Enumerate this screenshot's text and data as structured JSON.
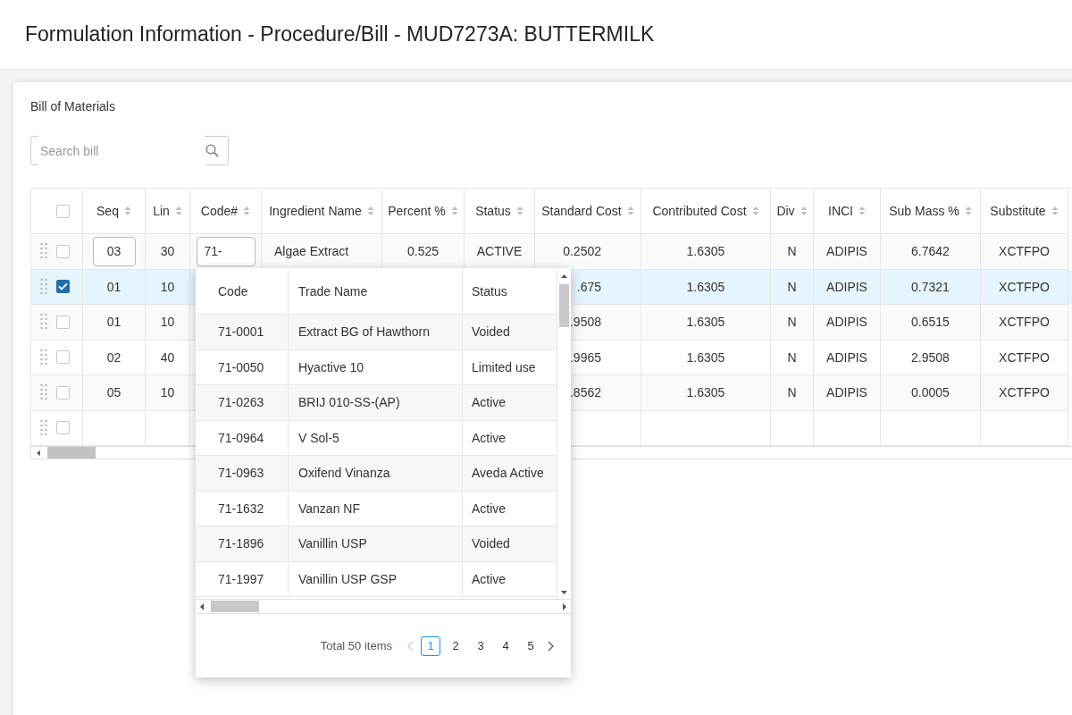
{
  "page_title": "Formulation Information - Procedure/Bill - MUD7273A: BUTTERMILK",
  "card_title": "Bill of Materials",
  "search": {
    "placeholder": "Search bill"
  },
  "table": {
    "all_checked": false,
    "columns": [
      {
        "label": "Seq"
      },
      {
        "label": "Lin"
      },
      {
        "label": "Code#"
      },
      {
        "label": "Ingredient Name"
      },
      {
        "label": "Percent %"
      },
      {
        "label": "Status"
      },
      {
        "label": "Standard Cost"
      },
      {
        "label": "Contributed Cost"
      },
      {
        "label": "Div"
      },
      {
        "label": "INCI"
      },
      {
        "label": "Sub Mass %"
      },
      {
        "label": "Substitute"
      }
    ],
    "rows": [
      {
        "selected": false,
        "editing": true,
        "seq": "03",
        "lin": "30",
        "code": "71-",
        "ingredient_name": "Algae Extract",
        "percent": "0.525",
        "status": "ACTIVE",
        "standard_cost": "0.2502",
        "contributed_cost": "1.6305",
        "div": "N",
        "inci": "ADIPIS",
        "sub_mass": "6.7642",
        "substitute": "XCTFPO"
      },
      {
        "selected": true,
        "editing": false,
        "seq": "01",
        "lin": "10",
        "standard_cost": ".675",
        "contributed_cost": "1.6305",
        "div": "N",
        "inci": "ADIPIS",
        "sub_mass": "0.7321",
        "substitute": "XCTFPO"
      },
      {
        "selected": false,
        "editing": false,
        "seq": "01",
        "lin": "10",
        "standard_cost": ".9508",
        "contributed_cost": "1.6305",
        "div": "N",
        "inci": "ADIPIS",
        "sub_mass": "0.6515",
        "substitute": "XCTFPO"
      },
      {
        "selected": false,
        "editing": false,
        "seq": "02",
        "lin": "40",
        "standard_cost": ".9965",
        "contributed_cost": "1.6305",
        "div": "N",
        "inci": "ADIPIS",
        "sub_mass": "2.9508",
        "substitute": "XCTFPO"
      },
      {
        "selected": false,
        "editing": false,
        "seq": "05",
        "lin": "10",
        "standard_cost": ".8562",
        "contributed_cost": "1.6305",
        "div": "N",
        "inci": "ADIPIS",
        "sub_mass": "0.0005",
        "substitute": "XCTFPO"
      },
      {
        "selected": false,
        "editing": false
      }
    ]
  },
  "lookup": {
    "columns": [
      {
        "label": "Code"
      },
      {
        "label": "Trade Name"
      },
      {
        "label": "Status"
      }
    ],
    "rows": [
      {
        "code": "71-0001",
        "trade_name": "Extract BG of Hawthorn",
        "status": "Voided"
      },
      {
        "code": "71-0050",
        "trade_name": "Hyactive 10",
        "status": "Limited use"
      },
      {
        "code": "71-0263",
        "trade_name": "BRIJ 010-SS-(AP)",
        "status": "Active"
      },
      {
        "code": "71-0964",
        "trade_name": "V Sol-5",
        "status": "Active"
      },
      {
        "code": "71-0963",
        "trade_name": "Oxifend Vinanza",
        "status": "Aveda Active"
      },
      {
        "code": "71-1632",
        "trade_name": "Vanzan NF",
        "status": "Active"
      },
      {
        "code": "71-1896",
        "trade_name": "Vanillin USP",
        "status": "Voided"
      },
      {
        "code": "71-1997",
        "trade_name": "Vanillin USP GSP",
        "status": "Active"
      }
    ],
    "pagination": {
      "total": "Total 50 items",
      "prev_disabled": true,
      "pages": [
        {
          "label": "1",
          "selected": true
        },
        {
          "label": "2",
          "selected": false
        },
        {
          "label": "3",
          "selected": false
        },
        {
          "label": "4",
          "selected": false
        },
        {
          "label": "5",
          "selected": false
        }
      ]
    }
  }
}
